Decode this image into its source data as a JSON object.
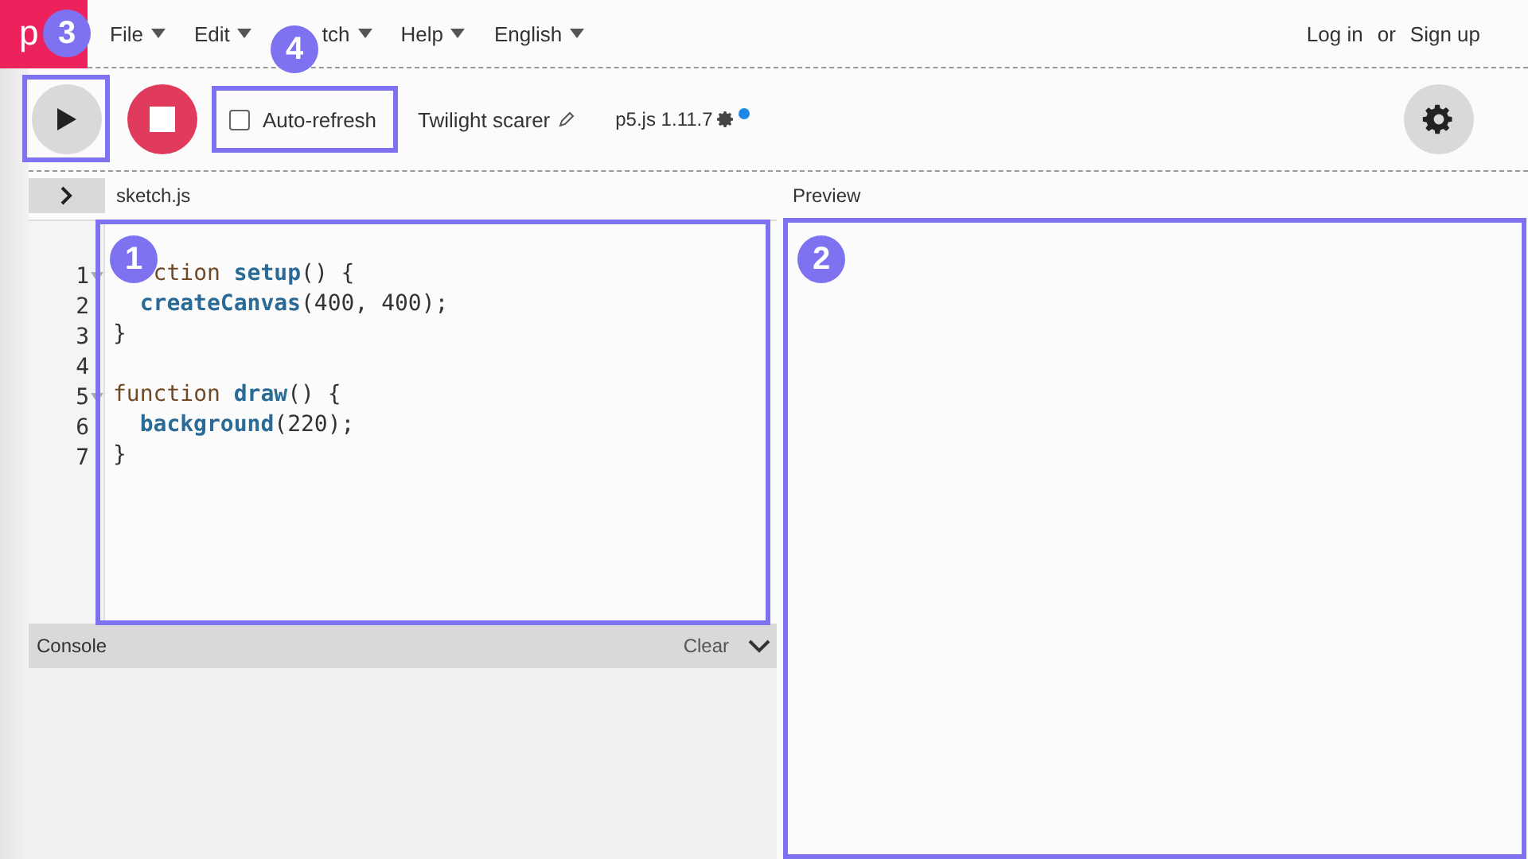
{
  "menu": {
    "logo": "p",
    "items": [
      {
        "label": "File",
        "kind": "full"
      },
      {
        "label": "Edit",
        "kind": "full"
      },
      {
        "label": "tch",
        "kind": "partial"
      },
      {
        "label": "Help",
        "kind": "full"
      },
      {
        "label": "English",
        "kind": "full"
      }
    ],
    "auth": {
      "login": "Log in",
      "separator": "or",
      "signup": "Sign up"
    }
  },
  "toolbar": {
    "auto_refresh": {
      "label": "Auto-refresh",
      "checked": false
    },
    "sketch_name": "Twilight scarer",
    "version": "p5.js 1.11.7",
    "update_dot": true
  },
  "editor": {
    "file_name": "sketch.js",
    "lines": [
      {
        "number": "1",
        "foldable": true,
        "covered": true,
        "indent": false,
        "tokens": [
          {
            "kind": "keyword",
            "text": "ction"
          },
          {
            "kind": "name",
            "text": "setup"
          },
          {
            "kind": "plain",
            "text": "() {"
          }
        ]
      },
      {
        "number": "2",
        "foldable": false,
        "covered": false,
        "indent": true,
        "tokens": [
          {
            "kind": "name",
            "text": "createCanvas"
          },
          {
            "kind": "plain",
            "text": "(400, 400);"
          }
        ]
      },
      {
        "number": "3",
        "foldable": false,
        "covered": false,
        "indent": false,
        "tokens": [
          {
            "kind": "plain",
            "text": "}"
          }
        ]
      },
      {
        "number": "4",
        "foldable": false,
        "covered": false,
        "indent": false
      },
      {
        "number": "5",
        "foldable": true,
        "covered": false,
        "indent": false,
        "tokens": [
          {
            "kind": "keyword",
            "text": "function"
          },
          {
            "kind": "name",
            "text": "draw"
          },
          {
            "kind": "plain",
            "text": "() {"
          }
        ]
      },
      {
        "number": "6",
        "foldable": false,
        "covered": false,
        "indent": true,
        "tokens": [
          {
            "kind": "name",
            "text": "background"
          },
          {
            "kind": "plain",
            "text": "(220);"
          }
        ]
      },
      {
        "number": "7",
        "foldable": false,
        "covered": false,
        "indent": false,
        "tokens": [
          {
            "kind": "plain",
            "text": "}"
          }
        ]
      }
    ]
  },
  "console": {
    "title": "Console",
    "clear": "Clear"
  },
  "preview": {
    "title": "Preview"
  },
  "annotations": [
    {
      "number": "1",
      "kind": "editor"
    },
    {
      "number": "2",
      "kind": "preview"
    },
    {
      "number": "3",
      "kind": "play"
    },
    {
      "number": "4",
      "kind": "auto_refresh"
    }
  ]
}
